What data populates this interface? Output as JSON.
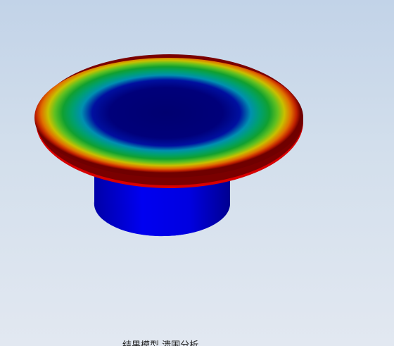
{
  "viewport": {
    "background_top": "#c2d3e8",
    "background_bottom": "#e2e8f1",
    "caption": "结果模型 溃围分析"
  },
  "model": {
    "description_type": "fea-result-plot",
    "colormap": [
      "#000080",
      "#0000d8",
      "#00a0c0",
      "#00a060",
      "#40c020",
      "#c0c000",
      "#e07000",
      "#d02000",
      "#800000"
    ],
    "flange_edge_color": "#e00000",
    "cylinder_color": "#0000e0"
  }
}
